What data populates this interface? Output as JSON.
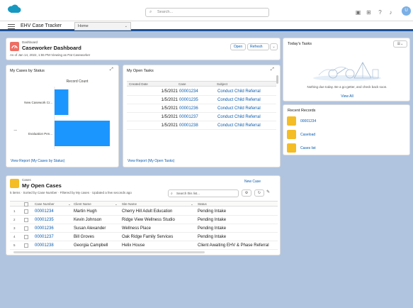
{
  "header": {
    "search_placeholder": "Search...",
    "avatar_initial": "U"
  },
  "nav": {
    "app_name": "EHV Case Tracker",
    "item_label": "Home"
  },
  "dashboard": {
    "type_label": "Dashboard",
    "title": "Caseworker Dashboard",
    "subtitle": "As of Jan 14, 2022, 1:55 PM·Viewing as Pat Caseworker",
    "btn_open": "Open",
    "btn_refresh": "Refresh"
  },
  "chart_card": {
    "title": "My Cases by Status",
    "legend_title": "Record Count",
    "footer_link": "View Report (My Cases by Status)"
  },
  "chart_data": {
    "type": "bar",
    "orientation": "horizontal",
    "categories": [
      "New Casework Cr...",
      "Evaluation Pen..."
    ],
    "values": [
      1,
      4
    ],
    "legend_title": "Record Count",
    "xlim": [
      0,
      4
    ]
  },
  "tasks_card": {
    "title": "My Open Tasks",
    "columns": [
      "Created Date",
      "Case",
      "Subject"
    ],
    "rows": [
      {
        "created": "1/5/2021",
        "case": "00001234",
        "subject": "Conduct Child Referral"
      },
      {
        "created": "1/5/2021",
        "case": "00001235",
        "subject": "Conduct Child Referral"
      },
      {
        "created": "1/5/2021",
        "case": "00001236",
        "subject": "Conduct Child Referral"
      },
      {
        "created": "1/5/2021",
        "case": "00001237",
        "subject": "Conduct Child Referral"
      },
      {
        "created": "1/5/2021",
        "case": "00001238",
        "subject": "Conduct Child Referral"
      }
    ],
    "footer_link": "View Report (My Open Tasks)"
  },
  "today_card": {
    "title": "Today's Tasks",
    "empty_text": "Nothing due today. Be a go-getter, and check back soon.",
    "footer_link": "View All"
  },
  "recent_card": {
    "title": "Recent Records",
    "items": [
      "00001234",
      "Caseload",
      "Cases list"
    ]
  },
  "cases_card": {
    "type_label": "Cases",
    "title": "My Open Cases",
    "meta": "5 items · Sorted by Case Number · Filtered by My cases · Updated a few seconds ago",
    "new_btn": "New Case",
    "search_placeholder": "Search this list...",
    "columns": [
      "Case Number",
      "Client Name",
      "Site Name",
      "Status"
    ],
    "rows": [
      {
        "num": "00001234",
        "client": "Martin Hugh",
        "site": "Cherry Hill Adult Education",
        "status": "Pending Intake"
      },
      {
        "num": "00001235",
        "client": "Kevin Johnson",
        "site": "Ridge View Wellness Studio",
        "status": "Pending Intake"
      },
      {
        "num": "00001236",
        "client": "Susan Alexander",
        "site": "Wellness Place",
        "status": "Pending Intake"
      },
      {
        "num": "00001237",
        "client": "Bill Groves",
        "site": "Oak Ridge Family Services",
        "status": "Pending Intake"
      },
      {
        "num": "00001238",
        "client": "Georgia Campbell",
        "site": "Helix House",
        "status": "Client Awaiting EHV & Phase Referral"
      }
    ]
  }
}
